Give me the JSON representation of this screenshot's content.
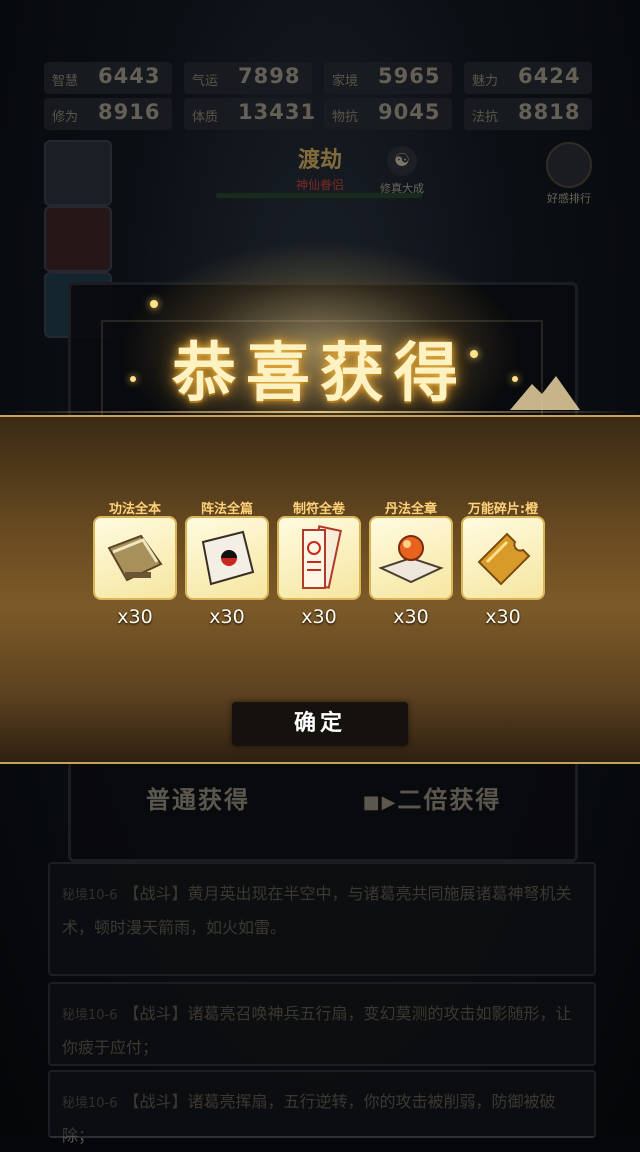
{
  "stats": [
    {
      "label": "智慧",
      "value": "6443"
    },
    {
      "label": "气运",
      "value": "7898"
    },
    {
      "label": "家境",
      "value": "5965"
    },
    {
      "label": "魅力",
      "value": "6424"
    },
    {
      "label": "修为",
      "value": "8916"
    },
    {
      "label": "体质",
      "value": "13431"
    },
    {
      "label": "物抗",
      "value": "9045"
    },
    {
      "label": "法抗",
      "value": "8818"
    }
  ],
  "stage": {
    "title": "渡劫",
    "subtitle": "神仙眷侣"
  },
  "realm": {
    "label": "修真大成"
  },
  "friend": {
    "label": "好感排行"
  },
  "dialog": {
    "headline": "恭喜获得",
    "confirm_label": "确定",
    "items": [
      {
        "name": "功法全本",
        "qty": "x30",
        "icon": "scroll-book-icon"
      },
      {
        "name": "阵法全篇",
        "qty": "x30",
        "icon": "talisman-paper-icon"
      },
      {
        "name": "制符全卷",
        "qty": "x30",
        "icon": "charm-papers-icon"
      },
      {
        "name": "丹法全章",
        "qty": "x30",
        "icon": "elixir-book-icon"
      },
      {
        "name": "万能碎片:橙",
        "qty": "x30",
        "icon": "puzzle-fragment-icon"
      }
    ]
  },
  "panel": {
    "normal_label": "普通获得",
    "double_label": "二倍获得"
  },
  "log": [
    {
      "tag": "秘境10-6",
      "text": "【战斗】黄月英出现在半空中，与诸葛亮共同施展诸葛神弩机关术，顿时漫天箭雨，如火如雷。"
    },
    {
      "tag": "秘境10-6",
      "text": "【战斗】诸葛亮召唤神兵五行扇，变幻莫测的攻击如影随形，让你疲于应付；"
    },
    {
      "tag": "秘境10-6",
      "text": "【战斗】诸葛亮挥扇，五行逆转，你的攻击被削弱，防御被破除；"
    }
  ],
  "colors": {
    "gold": "#ffd27a",
    "band": "#7d5a28",
    "confirm_bg": "#15120e"
  }
}
